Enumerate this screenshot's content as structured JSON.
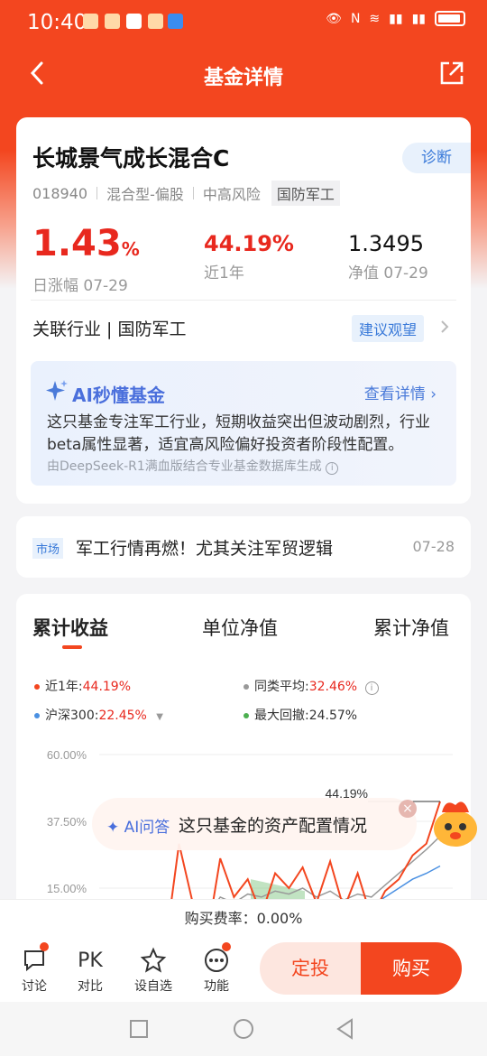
{
  "status_bar": {
    "time": "10:40"
  },
  "nav": {
    "title": "基金详情"
  },
  "fund": {
    "name": "长城景气成长混合C",
    "diagnose_label": "诊断",
    "code": "018940",
    "type": "混合型-偏股",
    "risk": "中高风险",
    "theme": "国防军工",
    "daily_change": "1.43",
    "daily_change_unit": "%",
    "daily_label": "日涨幅 07-29",
    "year_return": "44.19%",
    "year_label": "近1年",
    "nav_value": "1.3495",
    "nav_label": "净值 07-29"
  },
  "industry": {
    "text": "关联行业 | 国防军工",
    "advice": "建议观望"
  },
  "ai_summary": {
    "title": "AI秒懂基金",
    "more": "查看详情",
    "text": "这只基金专注军工行业，短期收益突出但波动剧烈，行业beta属性显著，适宜高风险偏好投资者阶段性配置。",
    "source": "由DeepSeek-R1满血版结合专业基金数据库生成"
  },
  "news": {
    "tag": "市场",
    "text": "军工行情再燃！尤其关注军贸逻辑",
    "date": "07-28"
  },
  "chart_tabs": [
    "累计收益",
    "单位净值",
    "累计净值"
  ],
  "legend": {
    "fund_label": "近1年:",
    "fund_value": "44.19%",
    "peer_label": "同类平均:",
    "peer_value": "32.46%",
    "index_label": "沪深300:",
    "index_value": "22.45%",
    "drawdown_label": "最大回撤:",
    "drawdown_value": "24.57%"
  },
  "colors": {
    "accent": "#f3461f",
    "fund_line": "#f3461f",
    "peer_line": "#999999",
    "index_line": "#4a90e2",
    "drawdown": "#4caf50"
  },
  "chart_data": {
    "type": "line",
    "y_ticks": [
      "60.00%",
      "37.50%",
      "15.00%"
    ],
    "ylim": [
      -7.5,
      60
    ],
    "end_label": "44.19%",
    "series": [
      {
        "name": "近1年",
        "values": [
          2,
          -5,
          30,
          10,
          -3,
          25,
          12,
          18,
          6,
          20,
          15,
          22,
          10,
          24,
          8,
          20,
          5,
          14,
          18,
          26,
          30,
          44.19
        ]
      },
      {
        "name": "同类平均",
        "values": [
          0,
          2,
          10,
          8,
          5,
          12,
          10,
          13,
          12,
          14,
          13,
          15,
          12,
          14,
          11,
          13,
          12,
          16,
          20,
          24,
          28,
          32.46
        ]
      },
      {
        "name": "沪深300",
        "values": [
          0,
          1,
          6,
          5,
          3,
          8,
          7,
          9,
          8,
          10,
          9,
          11,
          9,
          10,
          8,
          10,
          9,
          12,
          15,
          18,
          20,
          22.45
        ]
      }
    ]
  },
  "ai_bubble": {
    "label": "AI问答",
    "question": "这只基金的资产配置情况"
  },
  "fee": {
    "text": "购买费率：0.00%"
  },
  "bottom": {
    "discuss": "讨论",
    "compare_icon": "PK",
    "compare": "对比",
    "watch": "设自选",
    "func": "功能",
    "dingtou": "定投",
    "buy": "购买"
  }
}
